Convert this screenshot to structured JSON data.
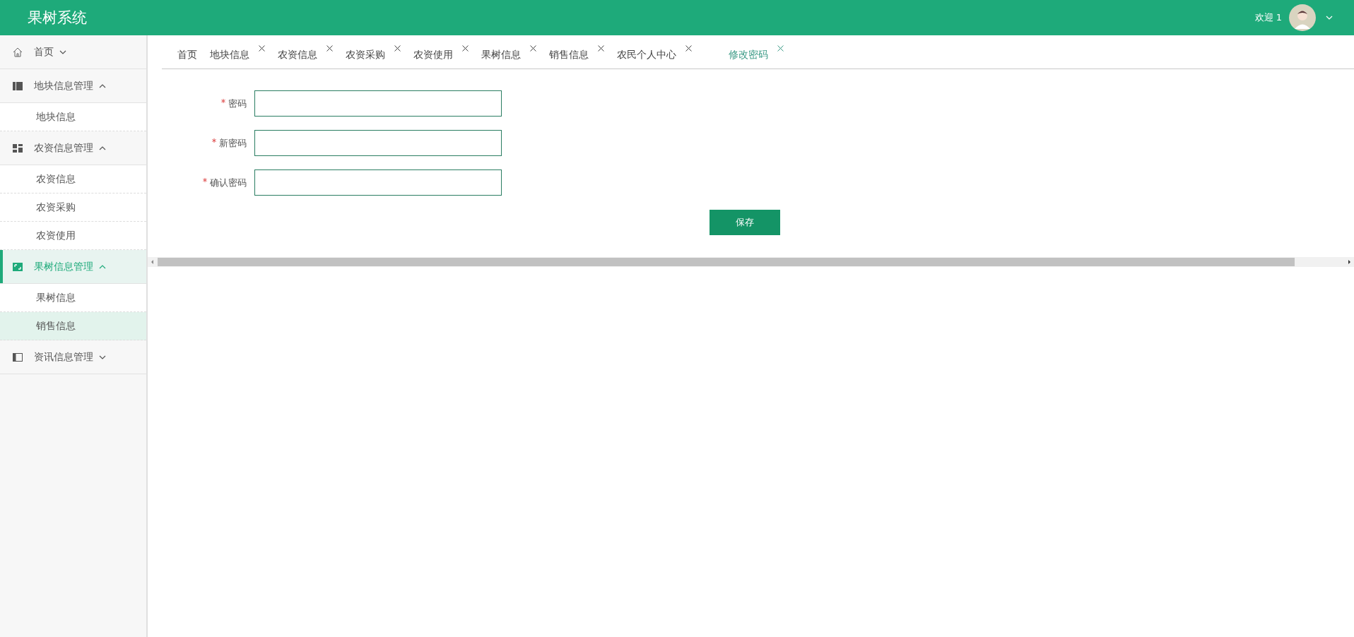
{
  "header": {
    "title": "果树系统",
    "welcome": "欢迎 1"
  },
  "sidebar": {
    "groups": [
      {
        "label": "首页",
        "expanded": false,
        "selected": false
      },
      {
        "label": "地块信息管理",
        "expanded": true,
        "selected": false,
        "items": [
          {
            "label": "地块信息",
            "selected": false
          }
        ]
      },
      {
        "label": "农资信息管理",
        "expanded": true,
        "selected": false,
        "items": [
          {
            "label": "农资信息",
            "selected": false
          },
          {
            "label": "农资采购",
            "selected": false
          },
          {
            "label": "农资使用",
            "selected": false
          }
        ]
      },
      {
        "label": "果树信息管理",
        "expanded": true,
        "selected": true,
        "items": [
          {
            "label": "果树信息",
            "selected": false
          },
          {
            "label": "销售信息",
            "selected": true
          }
        ]
      },
      {
        "label": "资讯信息管理",
        "expanded": false,
        "selected": false
      }
    ]
  },
  "tabs": [
    {
      "label": "首页",
      "closable": false,
      "selected": false
    },
    {
      "label": "地块信息",
      "closable": true,
      "selected": false
    },
    {
      "label": "农资信息",
      "closable": true,
      "selected": false
    },
    {
      "label": "农资采购",
      "closable": true,
      "selected": false
    },
    {
      "label": "农资使用",
      "closable": true,
      "selected": false
    },
    {
      "label": "果树信息",
      "closable": true,
      "selected": false
    },
    {
      "label": "销售信息",
      "closable": true,
      "selected": false
    },
    {
      "label": "农民个人中心",
      "closable": true,
      "selected": false
    },
    {
      "label": "修改密码",
      "closable": true,
      "selected": true
    }
  ],
  "form": {
    "fields": [
      {
        "label": "密码",
        "required": true
      },
      {
        "label": "新密码",
        "required": true
      },
      {
        "label": "确认密码",
        "required": true
      }
    ],
    "button": "保存"
  }
}
